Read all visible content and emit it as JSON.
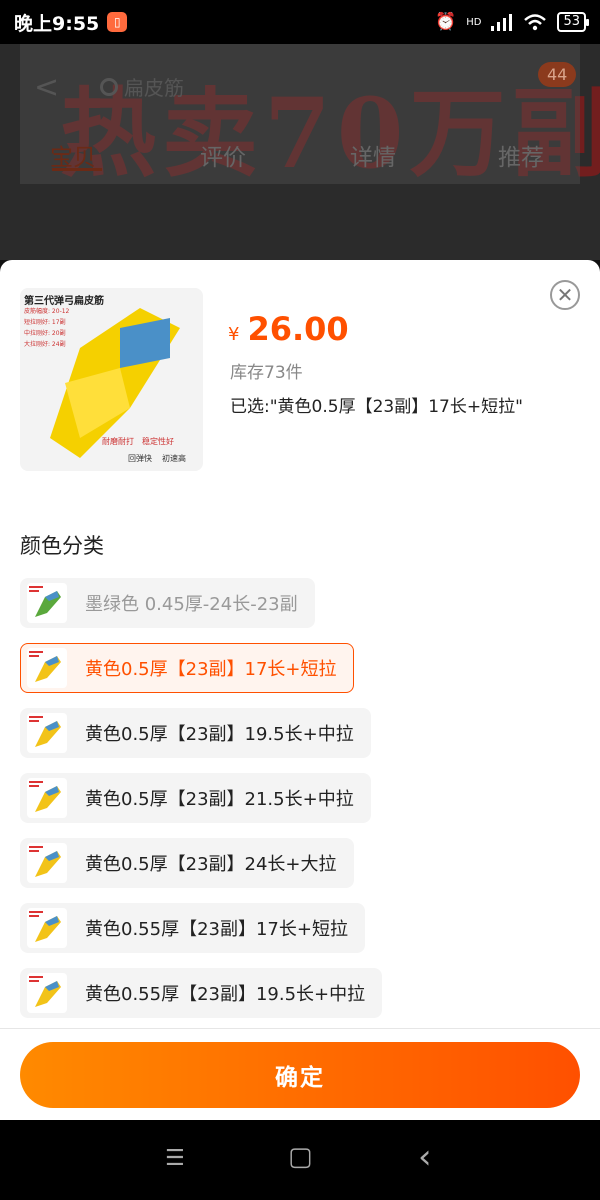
{
  "status_bar": {
    "time": "晚上9:55",
    "app_icon_glyph": "▯",
    "network": "HD",
    "battery": "53"
  },
  "background_page": {
    "hero_text": "热卖70万副",
    "back_glyph": "<",
    "search_text": "扁皮筋",
    "cart_badge": "44",
    "tabs": [
      "宝贝",
      "评价",
      "详情",
      "推荐"
    ]
  },
  "sheet": {
    "close_glyph": "✕",
    "image": {
      "title": "第三代弹弓扁皮筋",
      "lines": [
        "皮筋幅度: 20-12",
        "短拉刚好: 17副",
        "中拉刚好: 20副",
        "大拉刚好: 24副"
      ],
      "foot_red": [
        "耐磨耐打",
        "稳定性好"
      ],
      "foot_black": [
        "回弹快",
        "初速高"
      ]
    },
    "price": {
      "currency": "¥",
      "value": "26.00"
    },
    "stock": "库存73件",
    "selected": "已选:\"黄色0.5厚【23副】17长+短拉\"",
    "section_title": "颜色分类",
    "options": [
      {
        "label": "墨绿色 0.45厚-24长-23副",
        "state": "disabled",
        "thumb_color": "#5aa83c"
      },
      {
        "label": "黄色0.5厚【23副】17长+短拉",
        "state": "active",
        "thumb_color": "#f2c318"
      },
      {
        "label": "黄色0.5厚【23副】19.5长+中拉",
        "state": "normal",
        "thumb_color": "#f2c318"
      },
      {
        "label": "黄色0.5厚【23副】21.5长+中拉",
        "state": "normal",
        "thumb_color": "#f2c318"
      },
      {
        "label": "黄色0.5厚【23副】24长+大拉",
        "state": "normal",
        "thumb_color": "#f2c318"
      },
      {
        "label": "黄色0.55厚【23副】17长+短拉",
        "state": "normal",
        "thumb_color": "#f2c318"
      },
      {
        "label": "黄色0.55厚【23副】19.5长+中拉",
        "state": "normal",
        "thumb_color": "#f2c318"
      }
    ],
    "confirm_label": "确定"
  },
  "nav_bar": {
    "menu_glyph": "☰",
    "home_glyph": "▢",
    "back_glyph": "‹"
  },
  "colors": {
    "accent": "#ff5000",
    "accent_light": "#ff8a00"
  }
}
